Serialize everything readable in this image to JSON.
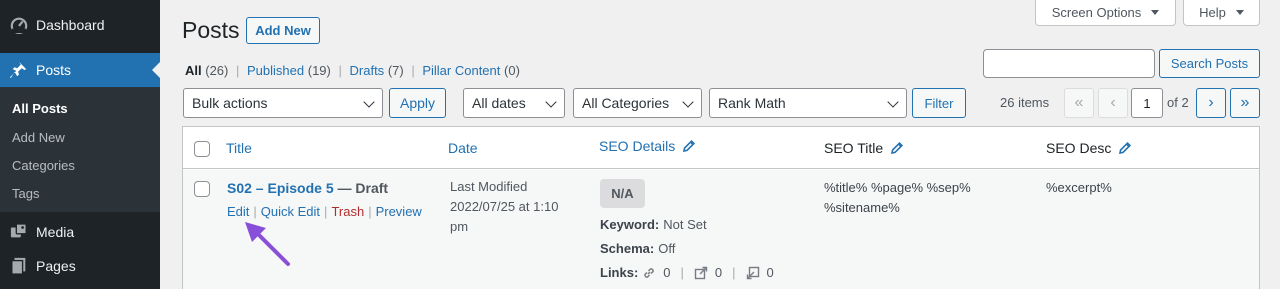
{
  "sidebar": {
    "items": [
      {
        "label": "Dashboard",
        "icon": "dashboard-icon"
      },
      {
        "label": "Posts",
        "icon": "pushpin-icon"
      },
      {
        "label": "Media",
        "icon": "media-icon"
      },
      {
        "label": "Pages",
        "icon": "pages-icon"
      }
    ],
    "submenu": [
      "All Posts",
      "Add New",
      "Categories",
      "Tags"
    ]
  },
  "header": {
    "title": "Posts",
    "add_new": "Add New",
    "screen_options": "Screen Options",
    "help": "Help"
  },
  "filters": {
    "views": [
      {
        "label": "All",
        "count": "(26)"
      },
      {
        "label": "Published",
        "count": "(19)"
      },
      {
        "label": "Drafts",
        "count": "(7)"
      },
      {
        "label": "Pillar Content",
        "count": "(0)"
      }
    ],
    "search_button": "Search Posts",
    "bulk_actions": "Bulk actions",
    "apply": "Apply",
    "dates": "All dates",
    "categories": "All Categories",
    "rank_math": "Rank Math",
    "filter": "Filter"
  },
  "pagination": {
    "items": "26 items",
    "first": "«",
    "prev": "‹",
    "page": "1",
    "of": "of 2",
    "next": "›",
    "last": "»"
  },
  "table": {
    "columns": [
      "Title",
      "Date",
      "SEO Details",
      "SEO Title",
      "SEO Desc"
    ],
    "row": {
      "title": "S02 – Episode 5",
      "state": " — Draft",
      "actions": [
        "Edit",
        "Quick Edit",
        "Trash",
        "Preview"
      ],
      "date_line1": "Last Modified",
      "date_line2": "2022/07/25 at 1:10",
      "date_line3": "pm",
      "seo_badge": "N/A",
      "keyword_label": "Keyword:",
      "keyword_value": "Not Set",
      "schema_label": "Schema:",
      "schema_value": "Off",
      "links_label": "Links:",
      "links_internal": "0",
      "links_external": "0",
      "links_incoming": "0",
      "seo_title_line1": "%title% %page% %sep%",
      "seo_title_line2": "%sitename%",
      "seo_desc": "%excerpt%"
    }
  },
  "colors": {
    "sidebar_bg": "#1d2327",
    "accent": "#2271b1",
    "annotation_arrow": "#8a4fd8"
  }
}
